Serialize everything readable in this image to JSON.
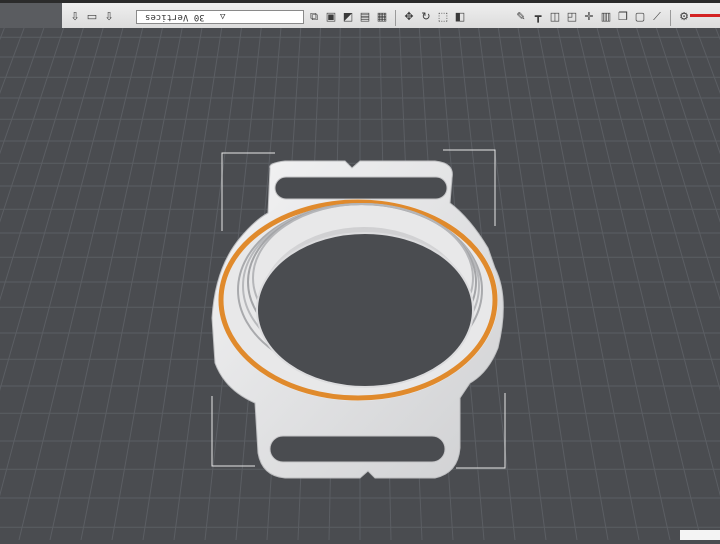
{
  "toolbar": {
    "stats_text": "30 Vertices",
    "left_icons": [
      "import-icon",
      "folder-icon",
      "export-icon"
    ],
    "view_icons": [
      "view-cube-icon",
      "front-view-icon",
      "iso-view-icon",
      "side-view-icon",
      "top-view-icon"
    ],
    "transform_icons": [
      "move-icon",
      "rotate-icon",
      "scale-icon",
      "mirror-icon"
    ],
    "tool_icons": [
      "pencil-icon",
      "measure-icon",
      "box-icon",
      "cube-icon",
      "align-icon",
      "layer-icon",
      "copy-icon",
      "clone-icon",
      "ruler-icon"
    ],
    "right_icons": [
      "settings-icon"
    ]
  },
  "viewport": {
    "object_name": "watch-bezel-model",
    "colors": {
      "background": "#4a4c50",
      "grid": "#5a5d62",
      "model": "#e9e9ea",
      "model_shadow": "#c7c8ca",
      "selection_ring": "#e08a2c",
      "bounding_box": "#e6e6e6"
    }
  }
}
